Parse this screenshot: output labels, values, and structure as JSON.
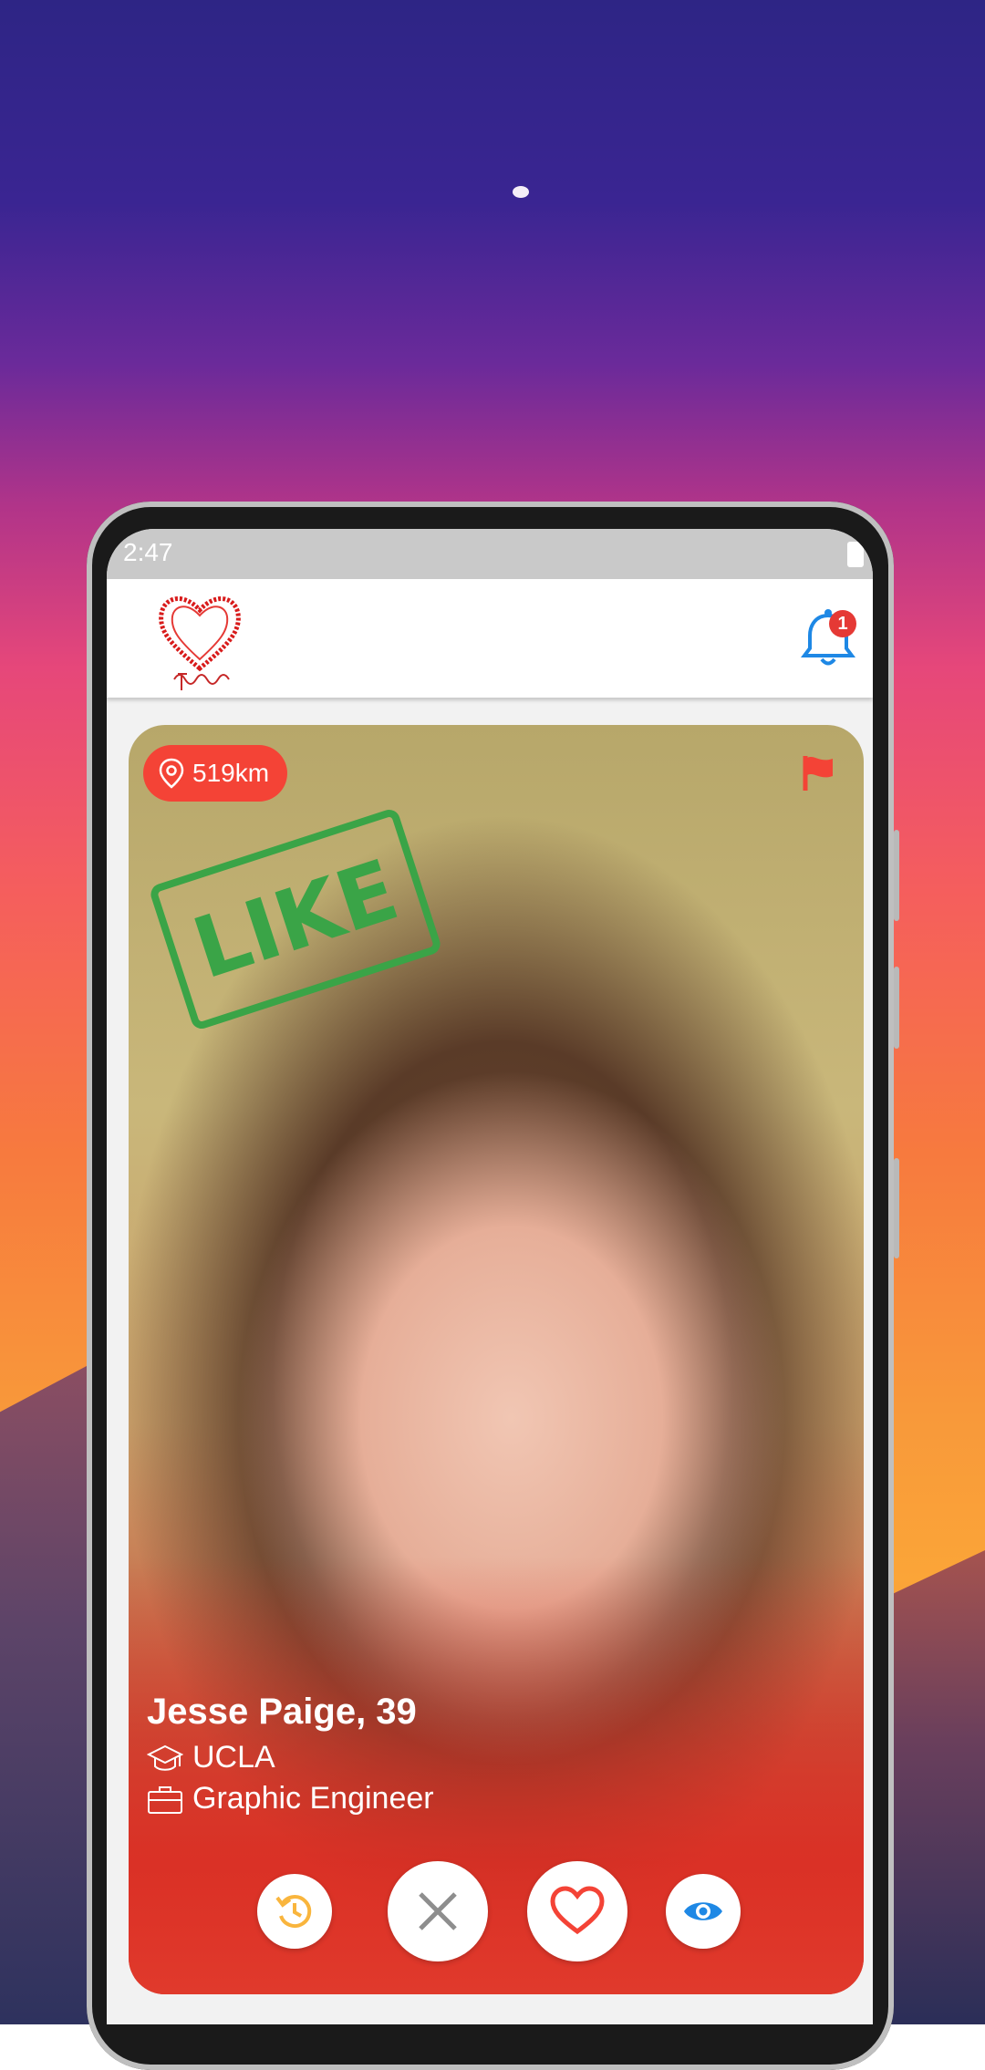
{
  "status_bar": {
    "time": "2:47"
  },
  "notifications": {
    "count": "1"
  },
  "profile": {
    "distance": "519km",
    "swipe_stamp": "LIKE",
    "name_age": "Jesse Paige, 39",
    "school": "UCLA",
    "job": "Graphic Engineer"
  },
  "colors": {
    "accent_red": "#f44336",
    "like_green": "#3aa447",
    "rewind_yellow": "#f9b53d",
    "boost_blue": "#1e88e5"
  },
  "icons": {
    "location": "location-pin-icon",
    "flag": "report-flag-icon",
    "school": "graduation-cap-icon",
    "job": "briefcase-icon",
    "rewind": "rewind-icon",
    "nope": "close-icon",
    "like": "heart-icon",
    "view": "eye-icon"
  }
}
